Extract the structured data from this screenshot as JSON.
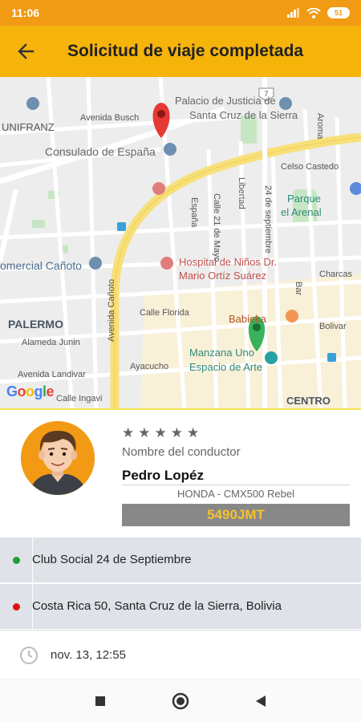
{
  "status_bar": {
    "time": "11:06",
    "battery": "51",
    "icons": [
      "signal-icon",
      "wifi-icon",
      "battery-icon"
    ]
  },
  "app_bar": {
    "title": "Solicitud de viaje completada",
    "back_icon": "arrow-back-icon"
  },
  "map": {
    "labels": {
      "unifranz": "UNIFRANZ",
      "avenida_busch": "Avenida Busch",
      "palacio": "Palacio de Justicia de",
      "santa_cruz_sierra": "Santa Cruz de la Sierra",
      "consulado": "Consulado de España",
      "celso": "Celso Castedo",
      "aroma": "Aroma",
      "parque": "Parque",
      "el_arenal": "el Arenal",
      "espana": "España",
      "calle21": "Calle 21 de Mayo",
      "libertad": "Libertad",
      "24sept": "24 de septiembre",
      "comercial": "omercial Cañoto",
      "hospital1": "Hospital de Niños Dr.",
      "hospital2": "Mario Ortíz Suárez",
      "charcas": "Charcas",
      "bar": "Bar",
      "palermo": "PALERMO",
      "calle_florida": "Calle Florida",
      "bolivar": "Bolivar",
      "avenida_canoto": "Avenida Cañoto",
      "babieka": "Babieka",
      "alameda": "Alameda Junin",
      "manzana1": "Manzana Uno",
      "manzana2": "Espacio de Arte",
      "ayacucho": "Ayacucho",
      "avenida_landivar": "Avenida Landivar",
      "calle_ingavi": "Calle Ingavi",
      "centro": "CENTRO",
      "google": "Google",
      "route_shield": "7"
    },
    "colors": {
      "origin_pin": "#34a853",
      "destination_pin": "#e53935",
      "ring_road": "#f7e07a"
    }
  },
  "driver": {
    "rating_stars": 5,
    "label": "Nombre del conductor",
    "name": "Pedro Lopéz",
    "vehicle": "HONDA - CMX500 Rebel",
    "plate": "5490JMT"
  },
  "route": {
    "origin": "Club Social 24 de Septiembre",
    "destination": "Costa Rica 50, Santa Cruz de la Sierra, Bolivia",
    "origin_color": "#1f9e35",
    "destination_color": "#e01010"
  },
  "trip": {
    "datetime": "nov. 13, 12:55",
    "icon": "clock-icon"
  },
  "nav_bar": {
    "icons": [
      "recents-square-icon",
      "home-circle-icon",
      "back-triangle-icon"
    ]
  },
  "colors": {
    "status_bar": "#f19a14",
    "app_bar": "#f6b40b",
    "plate_bg": "#888888",
    "plate_text": "#f6c32a"
  }
}
